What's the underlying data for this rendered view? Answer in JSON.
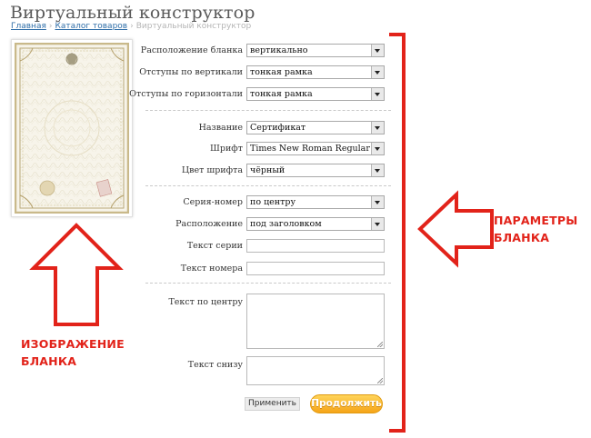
{
  "header": {
    "title": "Виртуальный конструктор",
    "breadcrumb": {
      "home": "Главная",
      "catalog": "Каталог товаров",
      "current": "Виртуальный конструктор"
    }
  },
  "form": {
    "layout": {
      "orientation_label": "Расположение бланка",
      "orientation_value": "вертикально",
      "vmargin_label": "Отступы по вертикали",
      "vmargin_value": "тонкая рамка",
      "hmargin_label": "Отступы по горизонтали",
      "hmargin_value": "тонкая рамка"
    },
    "title": {
      "name_label": "Название",
      "name_value": "Сертификат",
      "font_label": "Шрифт",
      "font_value": "Times New Roman Regular",
      "color_label": "Цвет шрифта",
      "color_value": "чёрный"
    },
    "serial": {
      "serial_label": "Серия-номер",
      "serial_value": "по центру",
      "position_label": "Расположение",
      "position_value": "под заголовком",
      "series_text_label": "Текст серии",
      "series_text_value": "",
      "number_text_label": "Текст номера",
      "number_text_value": ""
    },
    "text": {
      "center_label": "Текст по центру",
      "center_value": "",
      "bottom_label": "Текст снизу",
      "bottom_value": ""
    },
    "buttons": {
      "apply": "Применить",
      "continue": "Продолжить"
    }
  },
  "annotations": {
    "params": [
      "ПАРАМЕТРЫ",
      "БЛАНКА"
    ],
    "image": [
      "ИЗОБРАЖЕНИЕ",
      "БЛАНКА"
    ],
    "color": "#e2231a"
  },
  "colors": {
    "link": "#2f6ea8",
    "button_orange": "#f5a418",
    "certificate_border": "#c9b98a"
  },
  "icons": {
    "dropdown": "chevron-down-icon",
    "preview_seal": "emblem-icon",
    "preview_stamp": "stamp-icon"
  }
}
